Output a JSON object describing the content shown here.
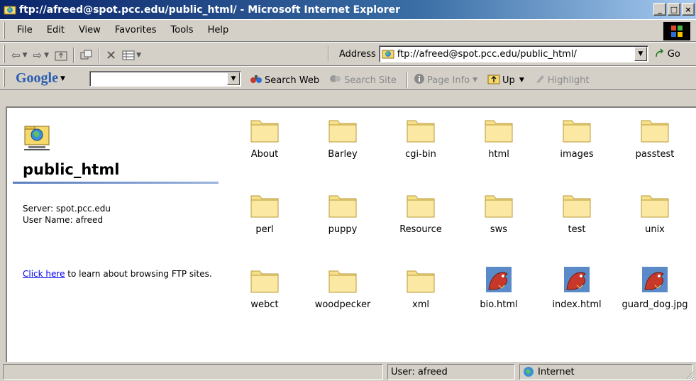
{
  "window": {
    "title": "ftp://afreed@spot.pcc.edu/public_html/ - Microsoft Internet Explorer",
    "controls": [
      "_",
      "□",
      "×"
    ]
  },
  "menu": {
    "items": [
      "File",
      "Edit",
      "View",
      "Favorites",
      "Tools",
      "Help"
    ]
  },
  "toolbar": {
    "address_label": "Address",
    "address_value": "ftp://afreed@spot.pcc.edu/public_html/",
    "go_label": "Go"
  },
  "google_bar": {
    "logo": "Google",
    "search_value": "",
    "search_web_label": "Search Web",
    "search_site_label": "Search Site",
    "page_info_label": "Page Info",
    "up_label": "Up",
    "highlight_label": "Highlight"
  },
  "left_pane": {
    "folder_name": "public_html",
    "server_line": "Server: spot.pcc.edu",
    "user_line": "User Name: afreed",
    "help_link": "Click here",
    "help_rest": " to learn about browsing FTP sites."
  },
  "items": [
    {
      "name": "About",
      "type": "folder"
    },
    {
      "name": "Barley",
      "type": "folder"
    },
    {
      "name": "cgi-bin",
      "type": "folder"
    },
    {
      "name": "html",
      "type": "folder"
    },
    {
      "name": "images",
      "type": "folder"
    },
    {
      "name": "passtest",
      "type": "folder"
    },
    {
      "name": "perl",
      "type": "folder"
    },
    {
      "name": "puppy",
      "type": "folder"
    },
    {
      "name": "Resource",
      "type": "folder"
    },
    {
      "name": "sws",
      "type": "folder"
    },
    {
      "name": "test",
      "type": "folder"
    },
    {
      "name": "unix",
      "type": "folder"
    },
    {
      "name": "webct",
      "type": "folder"
    },
    {
      "name": "woodpecker",
      "type": "folder"
    },
    {
      "name": "xml",
      "type": "folder"
    },
    {
      "name": "bio.html",
      "type": "file-dragon"
    },
    {
      "name": "index.html",
      "type": "file-dragon"
    },
    {
      "name": "guard_dog.jpg",
      "type": "file-dragon"
    }
  ],
  "status": {
    "left": "",
    "user": "User: afreed",
    "zone": "Internet"
  }
}
